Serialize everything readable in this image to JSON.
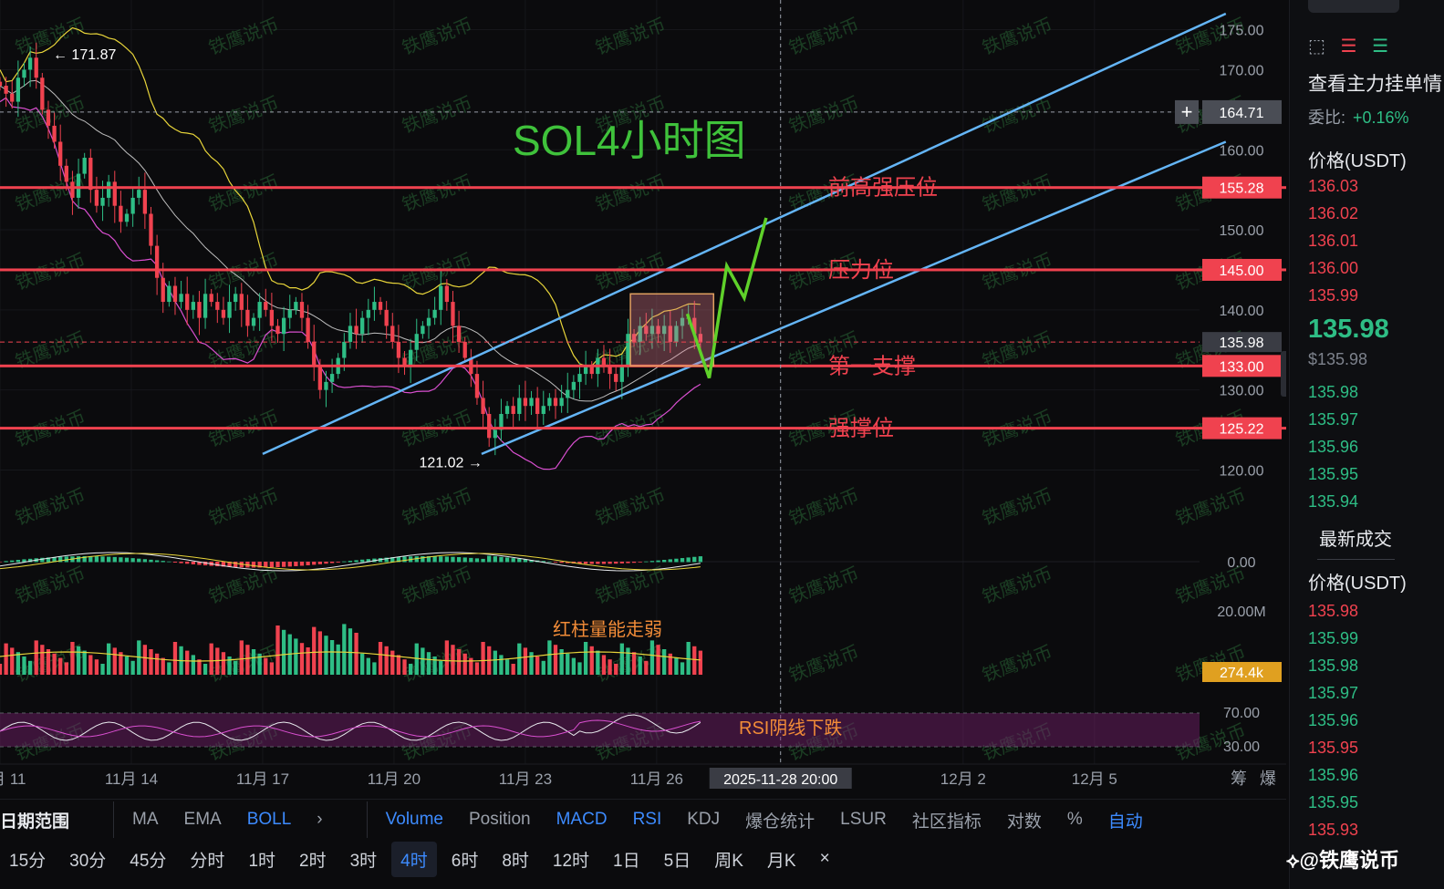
{
  "chart_data": {
    "type": "candlestick",
    "title": "SOL4小时图",
    "y_axis_labels": [
      "175.00",
      "170.00",
      "164.71",
      "160.00",
      "155.28",
      "150.00",
      "145.00",
      "140.00",
      "135.98",
      "133.00",
      "130.00",
      "125.22",
      "120.00"
    ],
    "ylim": [
      118,
      177
    ],
    "x_tick_labels": [
      "11月 11",
      "11月 14",
      "11月 17",
      "11月 20",
      "11月 23",
      "11月 26",
      "2025-11-28 20:00",
      "12月 2",
      "12月 5"
    ],
    "x_ticks_day": [
      11,
      14,
      17,
      20,
      23,
      26,
      28.83,
      33,
      36
    ],
    "xlim_day": [
      11,
      38.4
    ],
    "high_marker": {
      "label": "← 171.87",
      "value": 171.87,
      "day": 12
    },
    "low_marker": {
      "label": "121.02 →",
      "value": 121.02,
      "day": 22.2
    },
    "crosshair": {
      "price": 164.71,
      "label": "164.71",
      "day": 28.83
    },
    "current_price": {
      "value": 135.98,
      "label": "135.98"
    },
    "levels": [
      {
        "name": "前高强压位",
        "value": 155.28,
        "label": "155.28"
      },
      {
        "name": "压力位",
        "value": 145.0,
        "label": "145.00"
      },
      {
        "name": "第一支撑",
        "value": 133.0,
        "label": "133.00"
      },
      {
        "name": "强撑位",
        "value": 125.22,
        "label": "125.22"
      }
    ],
    "channel_lines": [
      {
        "from": [
          17,
          122
        ],
        "to": [
          39,
          177
        ]
      },
      {
        "from": [
          22,
          122
        ],
        "to": [
          39,
          161
        ]
      }
    ],
    "box": {
      "x0": 25.4,
      "x1": 27.3,
      "y_low": 133.0,
      "y_high": 142.0
    },
    "projection": [
      [
        26.7,
        139.5
      ],
      [
        27.2,
        131.5
      ],
      [
        27.6,
        145.5
      ],
      [
        28.0,
        141.5
      ],
      [
        28.5,
        151.5
      ]
    ],
    "closes": [
      168,
      167,
      166,
      169,
      170,
      171.5,
      169,
      165,
      163,
      161,
      158,
      156,
      154,
      157,
      159,
      155,
      153,
      154,
      156,
      153,
      151,
      152,
      154,
      155,
      152,
      148,
      144,
      141,
      143,
      141,
      142,
      140,
      141,
      139,
      142,
      141,
      140,
      139,
      141,
      142,
      140,
      138,
      139,
      141,
      140,
      138,
      137,
      139,
      140,
      141,
      139,
      136,
      133,
      130,
      131,
      132,
      134,
      136,
      138,
      137,
      139,
      140,
      141,
      140,
      138,
      136,
      134,
      133,
      135,
      137,
      138,
      139,
      140,
      143,
      141,
      138,
      136,
      134,
      132,
      129,
      127,
      124,
      125,
      127,
      128,
      127,
      129,
      128,
      129,
      127,
      128,
      129,
      128,
      129,
      130,
      131,
      132,
      133,
      132,
      134,
      133,
      132,
      131,
      133,
      137,
      136,
      138,
      137,
      138,
      137,
      138,
      136,
      138,
      139,
      139,
      137,
      136
    ]
  },
  "macd_panel": {
    "label_zero": "0.00"
  },
  "volume_panel": {
    "label_max": "20.00M",
    "label_current": "274.4k",
    "annotation": "红柱量能走弱"
  },
  "rsi_panel": {
    "label_upper": "70.00",
    "label_lower": "30.00",
    "annotation": "RSI阴线下跌"
  },
  "watermark": "铁鹰说币",
  "corner_labels": [
    "筹",
    "爆"
  ],
  "indicator_bar": {
    "items": [
      "日期范围",
      "MA",
      "EMA",
      "BOLL",
      "›",
      "Volume",
      "Position",
      "MACD",
      "RSI",
      "KDJ",
      "爆仓统计",
      "LSUR",
      "社区指标",
      "对数",
      "%",
      "自动"
    ],
    "active": [
      "BOLL",
      "Volume",
      "MACD",
      "RSI",
      "自动"
    ]
  },
  "interval_bar": {
    "items": [
      "15分",
      "30分",
      "45分",
      "分时",
      "1时",
      "2时",
      "3时",
      "4时",
      "6时",
      "8时",
      "12时",
      "1日",
      "5日",
      "周K",
      "月K",
      "×"
    ],
    "active": "4时"
  },
  "right_panel": {
    "title": "查看主力挂单情",
    "ratio_label": "委比:",
    "ratio_value": "+0.16%",
    "price_header": "价格(USDT)",
    "asks": [
      "136.03",
      "136.02",
      "136.01",
      "136.00",
      "135.99"
    ],
    "last_price": "135.98",
    "last_price_sub": "$135.98",
    "bids": [
      "135.98",
      "135.97",
      "135.96",
      "135.95",
      "135.94"
    ],
    "latest_trades_label": "最新成交",
    "trades_header": "价格(USDT)",
    "trades": [
      {
        "price": "135.98",
        "side": "sell"
      },
      {
        "price": "135.99",
        "side": "buy"
      },
      {
        "price": "135.98",
        "side": "buy"
      },
      {
        "price": "135.97",
        "side": "buy"
      },
      {
        "price": "135.96",
        "side": "buy"
      },
      {
        "price": "135.95",
        "side": "sell"
      },
      {
        "price": "135.96",
        "side": "buy"
      },
      {
        "price": "135.95",
        "side": "buy"
      },
      {
        "price": "135.93",
        "side": "sell"
      }
    ],
    "logo_text": "@铁鹰说币"
  },
  "colors": {
    "up": "#2ebd85",
    "down": "#f0424f",
    "level": "#f0424f",
    "channel": "#64b5f6",
    "projection": "#5fd12a",
    "box": "#c0504d",
    "boll_upper": "#e8d53a",
    "boll_mid": "#bfbfbf",
    "boll_lower": "#d94fd0",
    "title": "#3fc23b",
    "annotation": "#f28c38",
    "level_label": "#f0424f"
  }
}
